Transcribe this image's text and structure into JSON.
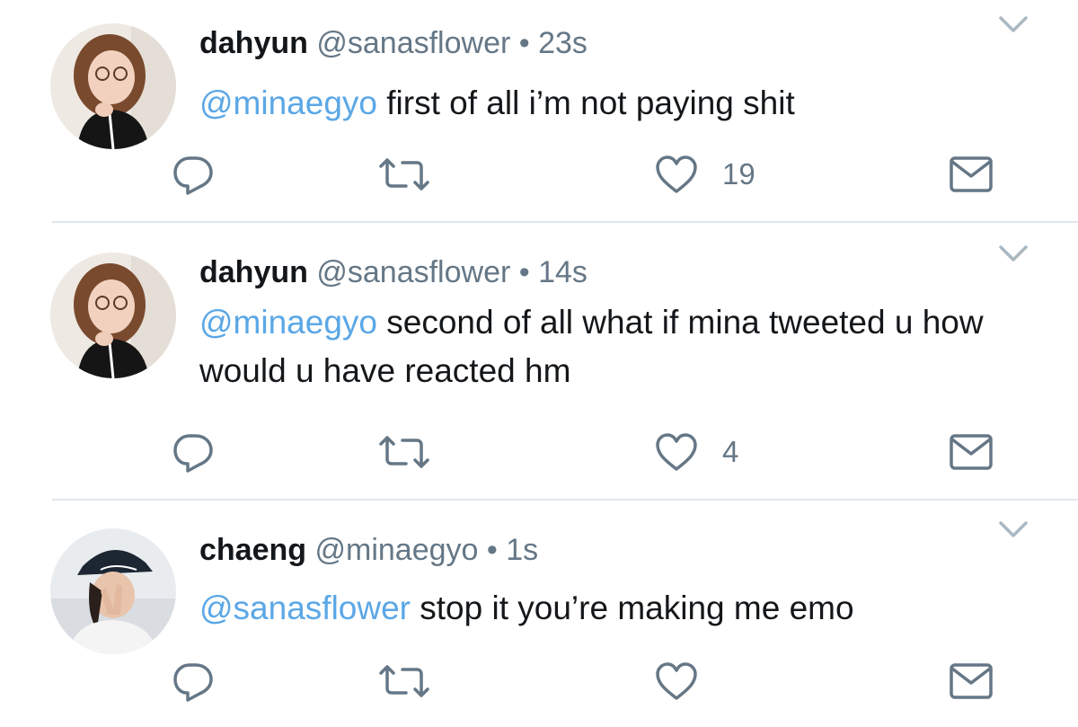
{
  "tweets": [
    {
      "name": "dahyun",
      "handle": "@sanasflower",
      "separator": "•",
      "time": "23s",
      "mention": "@minaegyo",
      "text": "first of all i’m not paying shit",
      "likes": "19"
    },
    {
      "name": "dahyun",
      "handle": "@sanasflower",
      "separator": "•",
      "time": "14s",
      "mention": "@minaegyo",
      "text": "second of all what if mina tweeted u how would u have reacted hm",
      "likes": "4"
    },
    {
      "name": "chaeng",
      "handle": "@minaegyo",
      "separator": "•",
      "time": "1s",
      "mention": "@sanasflower",
      "text": "stop it you’re making me emo",
      "likes": ""
    }
  ],
  "icons": {
    "menu": "chevron-down-icon",
    "reply": "reply-icon",
    "retweet": "retweet-icon",
    "like": "heart-icon",
    "dm": "envelope-icon"
  },
  "colors": {
    "mention": "#5ba7e6",
    "meta": "#657786",
    "text": "#14171a",
    "divider": "#e1e8ed",
    "icon": "#657786"
  }
}
